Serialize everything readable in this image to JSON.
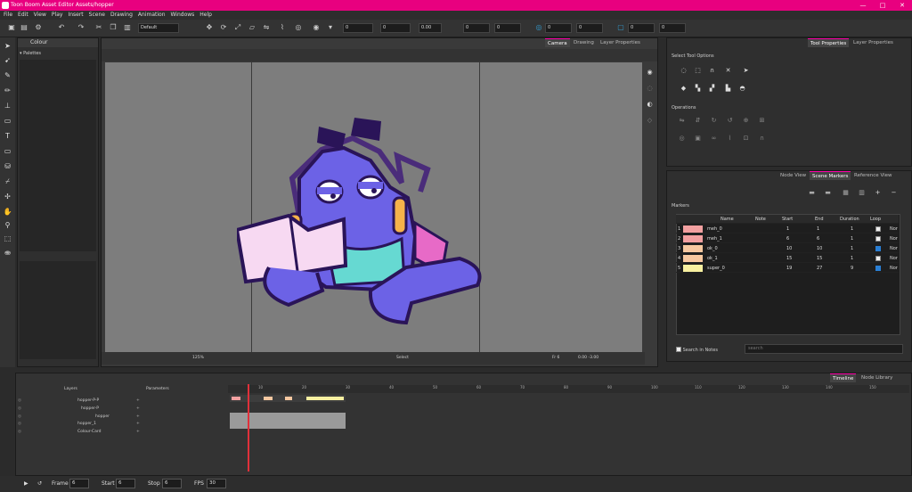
{
  "app": {
    "title": "Toon Boom Asset Editor Assets/hopper",
    "window_controls": [
      "—",
      "□",
      "✕"
    ]
  },
  "menu": [
    "File",
    "Edit",
    "View",
    "Play",
    "Insert",
    "Scene",
    "Drawing",
    "Animation",
    "Windows",
    "Help"
  ],
  "toolbar": {
    "workspace": "Default",
    "x": "0",
    "y": "0",
    "angle": "0.00",
    "fields": [
      "0",
      "0",
      "0",
      "0",
      "0",
      "0"
    ]
  },
  "colour_panel": {
    "title": "Colour",
    "section": "Palettes"
  },
  "camera_view": {
    "tabs": [
      "Camera",
      "Drawing",
      "Layer Properties"
    ],
    "active_tab": "Camera",
    "status_zoom": "125%",
    "status_tool": "Select",
    "status_frame": "Fr 6",
    "status_coords": "0.00 -3.00"
  },
  "tool_properties": {
    "tabs": [
      "Tool Properties",
      "Layer Properties"
    ],
    "active_tab": "Tool Properties",
    "select_tool_options": "Select Tool Options",
    "operations": "Operations"
  },
  "markers_panel": {
    "tabs": [
      "Node View",
      "Scene Markers",
      "Reference View"
    ],
    "active_tab": "Scene Markers",
    "title": "Markers",
    "headers": [
      "",
      "Name",
      "Note",
      "Start",
      "End",
      "Duration",
      "Loop"
    ],
    "rows": [
      {
        "num": "1",
        "color": "#f2a0a0",
        "name": "meh_0",
        "note": "",
        "start": "1",
        "end": "1",
        "duration": "1",
        "loop": false,
        "extra": "Nor"
      },
      {
        "num": "2",
        "color": "#f2a0a0",
        "name": "meh_1",
        "note": "",
        "start": "6",
        "end": "6",
        "duration": "1",
        "loop": false,
        "extra": "Nor"
      },
      {
        "num": "3",
        "color": "#f7c8a0",
        "name": "ok_0",
        "note": "",
        "start": "10",
        "end": "10",
        "duration": "1",
        "loop": true,
        "extra": "Nor"
      },
      {
        "num": "4",
        "color": "#f7c8a0",
        "name": "ok_1",
        "note": "",
        "start": "15",
        "end": "15",
        "duration": "1",
        "loop": false,
        "extra": "Nor"
      },
      {
        "num": "5",
        "color": "#f8f0a0",
        "name": "super_0",
        "note": "",
        "start": "19",
        "end": "27",
        "duration": "9",
        "loop": true,
        "extra": "Nor"
      }
    ],
    "search_label": "Search in Notes",
    "search_placeholder": "search"
  },
  "timeline": {
    "tabs": [
      "Timeline",
      "Node Library"
    ],
    "active_tab": "Timeline",
    "col_layers": "Layers",
    "col_params": "Parameters",
    "layers": [
      "hopper-P-P",
      "hopper-P",
      "hopper",
      "hopper_1",
      "Colour-Card"
    ],
    "ruler": [
      "10",
      "20",
      "30",
      "40",
      "50",
      "60",
      "70",
      "80",
      "90",
      "100",
      "110",
      "120",
      "130",
      "140",
      "150",
      "160"
    ]
  },
  "playback": {
    "frame_label": "Frame",
    "frame": "6",
    "start_label": "Start",
    "start": "6",
    "stop_label": "Stop",
    "stop": "6",
    "fps_label": "FPS",
    "fps": "30"
  }
}
